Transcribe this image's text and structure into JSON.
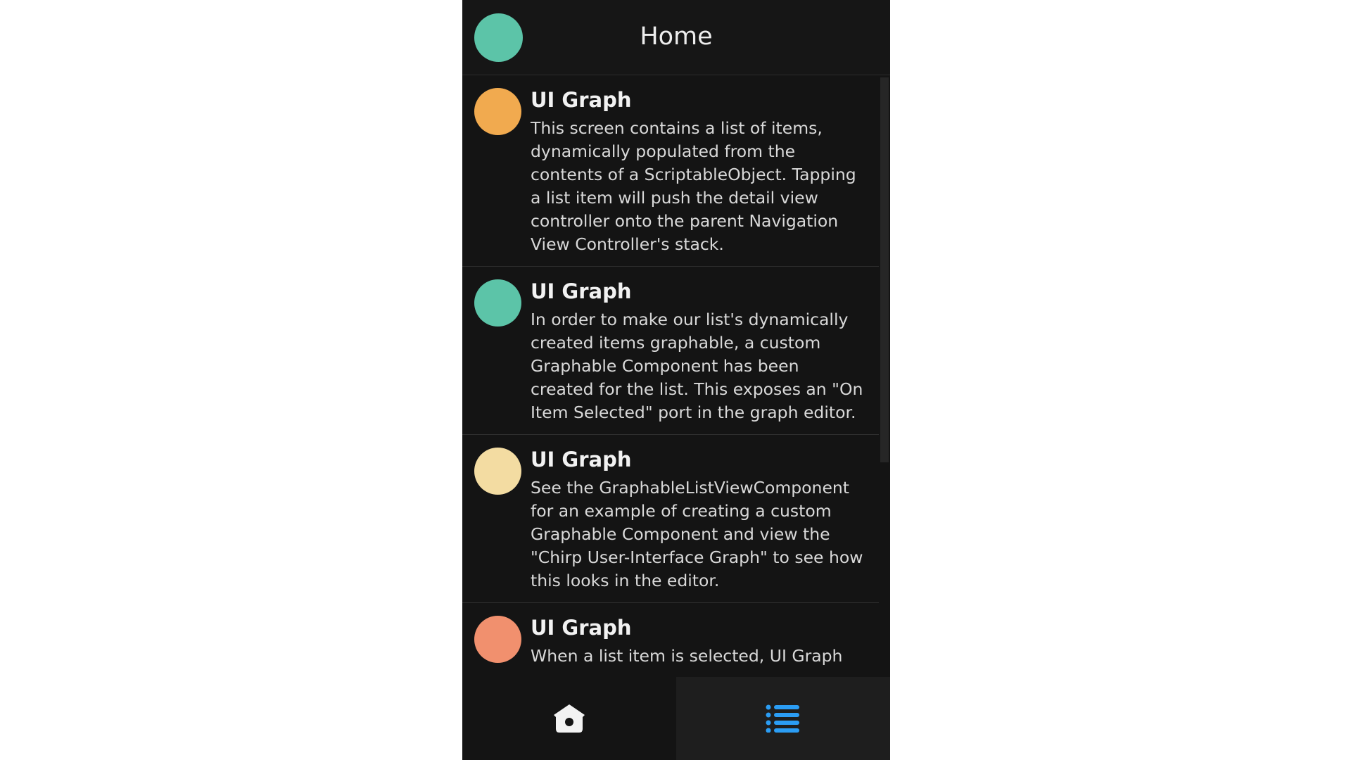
{
  "header": {
    "title": "Home",
    "avatar_color": "#5cc4a8"
  },
  "items": [
    {
      "title": "UI Graph",
      "body": "This screen contains a list of items, dynamically populated from the contents of a ScriptableObject. Tapping a list item will push the detail view controller onto the parent Navigation View Controller's stack.",
      "color": "#f1aa4f"
    },
    {
      "title": "UI Graph",
      "body": "In order to make our list's dynamically created items graphable, a custom Graphable Component has been created for the list. This exposes an \"On Item Selected\" port in the graph editor.",
      "color": "#5cc4a8"
    },
    {
      "title": "UI Graph",
      "body": "See the GraphableListViewComponent for an example of creating a custom Graphable Component and view the \"Chirp User-Interface Graph\" to see how this looks in the editor.",
      "color": "#f3dca2"
    },
    {
      "title": "UI Graph",
      "body": "When a list item is selected, UI Graph",
      "color": "#f1906e"
    }
  ],
  "tabbar": {
    "tabs": [
      {
        "icon": "birdhouse-icon",
        "color": "#f2f2f2",
        "selected": false
      },
      {
        "icon": "list-icon",
        "color": "#2b9df4",
        "selected": true
      }
    ]
  }
}
